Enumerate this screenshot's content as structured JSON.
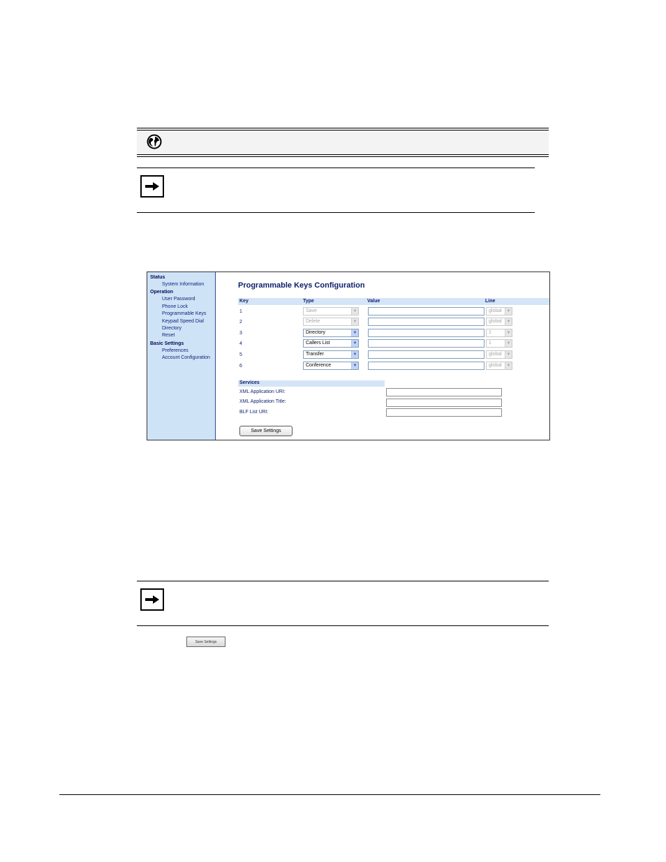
{
  "icons": {
    "globe": "globe-icon",
    "note": "arrow-right-icon"
  },
  "nav": {
    "status": "Status",
    "system_information": "System Information",
    "operation": "Operation",
    "user_password": "User Password",
    "phone_lock": "Phone Lock",
    "programmable_keys": "Programmable Keys",
    "keypad_speed_dial": "Keypad Speed Dial",
    "directory": "Directory",
    "reset": "Reset",
    "basic_settings": "Basic Settings",
    "preferences": "Preferences",
    "account_configuration": "Account Configuration"
  },
  "main": {
    "title": "Programmable Keys Configuration",
    "columns": {
      "key": "Key",
      "type": "Type",
      "value": "Value",
      "line": "Line"
    },
    "rows": [
      {
        "key": "1",
        "type": "Save",
        "value": "",
        "line": "global",
        "type_disabled": true,
        "line_disabled": true
      },
      {
        "key": "2",
        "type": "Delete",
        "value": "",
        "line": "global",
        "type_disabled": true,
        "line_disabled": true
      },
      {
        "key": "3",
        "type": "Directory",
        "value": "",
        "line": "1",
        "type_disabled": false,
        "line_disabled": true
      },
      {
        "key": "4",
        "type": "Callers List",
        "value": "",
        "line": "1",
        "type_disabled": false,
        "line_disabled": true
      },
      {
        "key": "5",
        "type": "Transfer",
        "value": "",
        "line": "global",
        "type_disabled": false,
        "line_disabled": true
      },
      {
        "key": "6",
        "type": "Conference",
        "value": "",
        "line": "global",
        "type_disabled": false,
        "line_disabled": true
      }
    ],
    "services": {
      "header": "Services",
      "xml_uri_label": "XML Application URI:",
      "xml_title_label": "XML Application Title:",
      "blf_uri_label": "BLF List URI:",
      "xml_uri_value": "",
      "xml_title_value": "",
      "blf_uri_value": ""
    },
    "save_button": "Save Settings"
  },
  "inline_button": "Save Settings",
  "colors": {
    "nav_bg": "#cfe3f7",
    "header_bg": "#d5e5f7",
    "title": "#0b1f6b"
  }
}
